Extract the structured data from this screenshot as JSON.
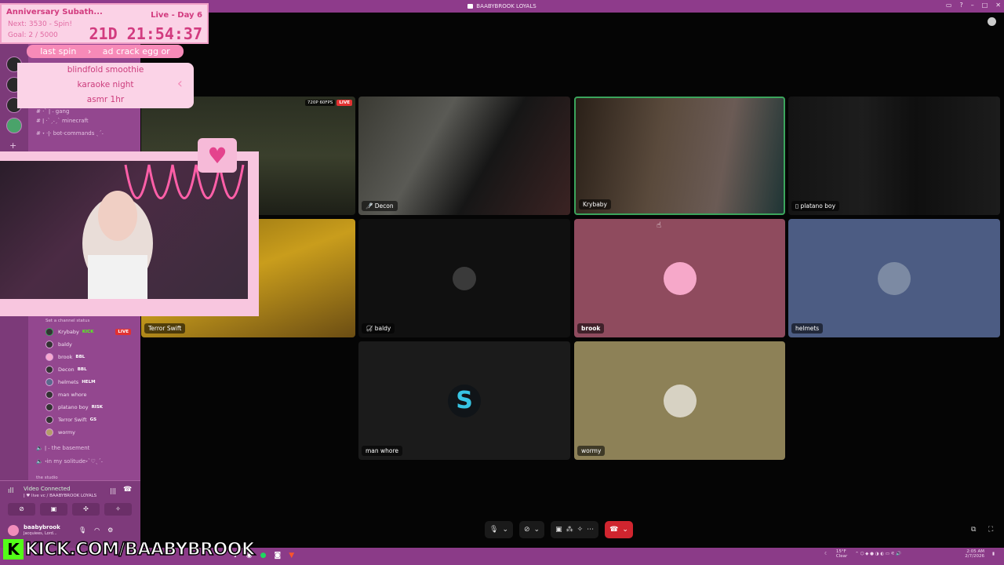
{
  "window": {
    "title": "BAABYBROOK LOYALS"
  },
  "subathon": {
    "title": "Anniversary Subath...",
    "day": "Live - Day 6",
    "next": "Next: 3530 - Spin!",
    "goal": "Goal: 2 / 5000",
    "timer": "21D 21:54:37"
  },
  "spin": {
    "last_label": "last spin",
    "arrow": "›",
    "last_value": "ad crack egg or",
    "items": [
      "blindfold smoothie",
      "karaoke night",
      "asmr 1hr"
    ],
    "collapse": "‹"
  },
  "channels": {
    "text": [
      "ǀ ·ˋˏ˗ˏˋ minecraft",
      "˖ ·ǀ· bot-commands ˎˊ˗",
      "·ˋ ǀ ˗ gang"
    ],
    "channel_status": "Set a channel status",
    "voice_users": [
      {
        "name": "Krybaby",
        "tag": "KICK",
        "live": "LIVE"
      },
      {
        "name": "baldy",
        "tag": ""
      },
      {
        "name": "brook",
        "tag": "BBL"
      },
      {
        "name": "Decon",
        "tag": "BBL"
      },
      {
        "name": "helmets",
        "tag": "HELM"
      },
      {
        "name": "man whore",
        "tag": ""
      },
      {
        "name": "platano boy",
        "tag": "RISK"
      },
      {
        "name": "Terror Swift",
        "tag": "GS"
      },
      {
        "name": "wormy",
        "tag": ""
      }
    ],
    "after": [
      "ǀ ˗ the basement",
      "˖in my solitude˖ˋ♡ˎˊ˗",
      "the studio"
    ]
  },
  "voice_panel": {
    "status": "Video Connected",
    "sub": "ǀ ♥ live vc / BAABYBROOK LOYALS",
    "user": "baabybrook",
    "user_sub": "Jacquiees, Lord..."
  },
  "stream_badge": {
    "quality": "720P 60FPS",
    "live": "LIVE"
  },
  "tiles": [
    {
      "name": "Decon"
    },
    {
      "name": "Krybaby"
    },
    {
      "name": "platano boy"
    },
    {
      "name": "Terror Swift"
    },
    {
      "name": "baldy"
    },
    {
      "name": "brook"
    },
    {
      "name": "helmets"
    },
    {
      "name": "man whore"
    },
    {
      "name": "wormy"
    }
  ],
  "branding": {
    "kick": "KICK.COM/BAABYBROOK",
    "kick_letter": "K"
  },
  "tray": {
    "weather_temp": "15°F",
    "weather_desc": "Clear",
    "time": "2:05 AM",
    "date": "2/7/2026"
  },
  "colors": {
    "accent": "#8e3b8b",
    "live": "#e23131",
    "speaking_border": "#3ba55c",
    "hangup": "#d0252f",
    "kick_green": "#53fc18"
  }
}
